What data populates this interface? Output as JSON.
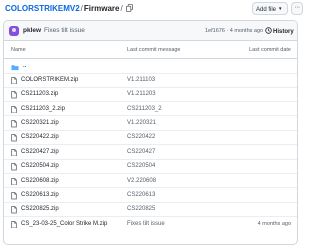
{
  "breadcrumb": {
    "repo": "COLORSTRIKEMV2",
    "sep1": "/",
    "folder": "Firmware",
    "sep2": "/"
  },
  "toolbar": {
    "add_file_label": "Add file",
    "more_label": "···"
  },
  "latest_commit": {
    "author": "pklew",
    "message": "Fixes tilt issue",
    "hash_and_time": "1ef1676 · 4 months ago",
    "history_label": "History"
  },
  "table": {
    "headers": {
      "name": "Name",
      "message": "Last commit message",
      "date": "Last commit date"
    },
    "parent_dir": "..",
    "rows": [
      {
        "name": "COLORSTRIKEM.zip",
        "message": "V1.211103",
        "date": ""
      },
      {
        "name": "CS211203.zip",
        "message": "V1.211203",
        "date": ""
      },
      {
        "name": "CS211203_2.zip",
        "message": "CS211203_2",
        "date": ""
      },
      {
        "name": "CS220321.zip",
        "message": "V1.220321",
        "date": ""
      },
      {
        "name": "CS220422.zip",
        "message": "CS220422",
        "date": ""
      },
      {
        "name": "CS220427.zip",
        "message": "CS220427",
        "date": ""
      },
      {
        "name": "CS220504.zip",
        "message": "CS220504",
        "date": ""
      },
      {
        "name": "CS220608.zip",
        "message": "V2.220608",
        "date": ""
      },
      {
        "name": "CS220613.zip",
        "message": "CS220613",
        "date": ""
      },
      {
        "name": "CS220825.zip",
        "message": "CS220825",
        "date": ""
      },
      {
        "name": "CS_23-03-25_Color Strike M.zip",
        "message": "Fixes tilt issue",
        "date": "4 months ago"
      }
    ]
  },
  "icons": {
    "file": "file-icon",
    "folder": "folder-icon",
    "copy": "copy-icon",
    "history": "history-icon",
    "avatar": "avatar"
  },
  "colors": {
    "link": "#0969da",
    "muted": "#57606a",
    "border": "#d0d7de",
    "header_bg": "#f6f8fa",
    "avatar": "#8250df"
  }
}
